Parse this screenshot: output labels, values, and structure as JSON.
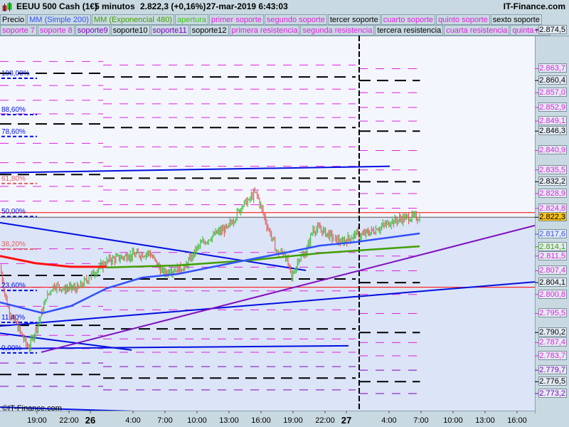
{
  "header": {
    "title": "EEUU 500 Cash (1€)",
    "timeframe": "5 minutos",
    "price": "2.822,3 (+0,16%)",
    "datetime": "27-mar-2019 6:43:03",
    "brand": "IT-Finance.com"
  },
  "legend_row1": [
    {
      "label": "Precio",
      "color": "#000000"
    },
    {
      "label": "MM (Simple 200)",
      "color": "#3050ff"
    },
    {
      "label": "MM (Exponencial 480)",
      "color": "#40a000"
    },
    {
      "label": "apertura",
      "color": "#40c020"
    },
    {
      "label": "primer soporte",
      "color": "#e020e0"
    },
    {
      "label": "segundo soporte",
      "color": "#e020e0"
    },
    {
      "label": "tercer soporte",
      "color": "#000000"
    },
    {
      "label": "cuarto soporte",
      "color": "#e020e0"
    },
    {
      "label": "quinto soporte",
      "color": "#e020e0"
    },
    {
      "label": "sexto soporte",
      "color": "#000000"
    }
  ],
  "legend_row2": [
    {
      "label": "soporte 7",
      "color": "#e020e0"
    },
    {
      "label": "soporte 8",
      "color": "#e020e0"
    },
    {
      "label": "soporte9",
      "color": "#8000c0"
    },
    {
      "label": "soporte10",
      "color": "#000000"
    },
    {
      "label": "soporte11",
      "color": "#8000c0"
    },
    {
      "label": "soporte12",
      "color": "#000000"
    },
    {
      "label": "primera resistencia",
      "color": "#e020e0"
    },
    {
      "label": "segunda resistencia",
      "color": "#e020e0"
    },
    {
      "label": "tercera resistencia",
      "color": "#000000"
    },
    {
      "label": "cuarta resistencia",
      "color": "#e020e0"
    },
    {
      "label": "quinta resi",
      "color": "#e020e0"
    }
  ],
  "copyright": "©IT-Finance.com",
  "chart_data": {
    "type": "candlestick",
    "title": "EEUU 500 Cash (1€) 5 minutos",
    "xunit": "hours from 26-mar 00:00",
    "xlim": [
      -8.47,
      41.67
    ],
    "ylim": [
      2767.0,
      2874.5
    ],
    "price": {
      "t": [
        -8.47,
        -7.8,
        -7.13,
        -5.8,
        -4.8,
        -4.13,
        -3.47,
        -2.47,
        -1.13,
        -0.13,
        0.87,
        1.87,
        3.53,
        5.53,
        6.87,
        7.53,
        8.87,
        10.2,
        11.53,
        12.87,
        14.2,
        14.87,
        15.53,
        16.2,
        16.87,
        17.53,
        18.2,
        18.87,
        19.53,
        20.2,
        20.87,
        21.53,
        22.87,
        23.53,
        24.87,
        25.53,
        26.87,
        28.2,
        29.53,
        30.87
      ],
      "p": [
        2808.5,
        2797.6,
        2793.6,
        2785.7,
        2793.6,
        2799.6,
        2803.5,
        2802.5,
        2802.5,
        2805.5,
        2808.5,
        2810.5,
        2811.5,
        2812.4,
        2806.5,
        2807.5,
        2808.5,
        2814.4,
        2817.4,
        2819.4,
        2825.3,
        2827.3,
        2829.3,
        2823.3,
        2817.4,
        2812.4,
        2812.4,
        2805.5,
        2810.5,
        2812.4,
        2819.0,
        2819.0,
        2816.4,
        2815.4,
        2817.4,
        2817.4,
        2819.0,
        2821.0,
        2822.3,
        2822.3
      ]
    },
    "ma200": {
      "name": "MM (Simple 200)",
      "color": "#3050ff",
      "t": [
        -8.47,
        -4.47,
        -1.8,
        1.53,
        4.87,
        8.2,
        11.53,
        14.87,
        18.2,
        21.53,
        24.87,
        30.87
      ],
      "p": [
        2798.6,
        2795.6,
        2797.6,
        2802.5,
        2805.5,
        2806.5,
        2808.5,
        2810.5,
        2812.4,
        2814.4,
        2815.4,
        2817.8
      ]
    },
    "ema_red": {
      "color": "#ff1010",
      "t": [
        -8.47,
        -5.13,
        -1.8,
        1.53
      ],
      "p": [
        2811.5,
        2809.5,
        2808.5,
        2808.5
      ]
    },
    "ema480": {
      "name": "MM (Exponencial 480)",
      "color": "#40a000",
      "t": [
        1.53,
        8.2,
        14.87,
        21.53,
        24.87,
        30.87
      ],
      "p": [
        2808.3,
        2808.9,
        2810.3,
        2812.3,
        2813.0,
        2814.2
      ]
    },
    "trendlines": [
      {
        "color": "#0010e0",
        "from": [
          -8.47,
          2834.7
        ],
        "to": [
          28.07,
          2836.5
        ]
      },
      {
        "color": "#0010e0",
        "from": [
          -8.47,
          2820.8
        ],
        "to": [
          20.2,
          2807.5
        ]
      },
      {
        "color": "#0010e0",
        "from": [
          -8.47,
          2792.0
        ],
        "to": [
          41.67,
          2804.3
        ]
      },
      {
        "color": "#0010e0",
        "from": [
          -8.47,
          2790.0
        ],
        "to": [
          3.87,
          2785.3
        ]
      },
      {
        "color": "#0010e0",
        "from": [
          -8.47,
          2785.7
        ],
        "to": [
          24.2,
          2786.5
        ]
      },
      {
        "color": "#0010e0",
        "from": [
          -8.47,
          2769.4
        ],
        "to": [
          8.87,
          2767.8
        ]
      },
      {
        "color": "#8010c0",
        "from": [
          -4.6,
          2784.7
        ],
        "to": [
          41.67,
          2820.0
        ]
      }
    ],
    "hlines": [
      {
        "color": "#ff0000",
        "p": 2823.6
      },
      {
        "color": "#ff0000",
        "p": 2802.8
      },
      {
        "color": "#555555",
        "p": 2822.3
      }
    ],
    "session_break_t": 25.2,
    "fib": [
      {
        "label": "100,00%",
        "p": 2862.2,
        "color": "#0010e0"
      },
      {
        "label": "88,60%",
        "p": 2852.1,
        "color": "#0010e0"
      },
      {
        "label": "78,60%",
        "p": 2846.0,
        "color": "#0010e0"
      },
      {
        "label": "61,80%",
        "p": 2832.9,
        "color": "#e06060"
      },
      {
        "label": "50,00%",
        "p": 2823.7,
        "color": "#0010e0"
      },
      {
        "label": "38,20%",
        "p": 2814.6,
        "color": "#e06060"
      },
      {
        "label": "23,60%",
        "p": 2803.1,
        "color": "#0010e0"
      },
      {
        "label": "11,40%",
        "p": 2794.2,
        "color": "#0010e0"
      },
      {
        "label": "0,00%",
        "p": 2785.7,
        "color": "#0010e0"
      }
    ],
    "level_segments": [
      {
        "t0": -8.47,
        "t1": 1.2,
        "shift": 2.0
      },
      {
        "t0": 1.2,
        "t1": 24.87,
        "shift": 1.0
      },
      {
        "t0": 25.2,
        "t1": 30.9,
        "shift": 0
      }
    ],
    "axis_labels": [
      {
        "label": "2.874,5",
        "p": 2874.5,
        "color": "#000000"
      },
      {
        "label": "2.863,7",
        "p": 2863.7,
        "color": "#e020e0"
      },
      {
        "label": "2.860,4",
        "p": 2860.4,
        "color": "#000000"
      },
      {
        "label": "2.857,0",
        "p": 2857.0,
        "color": "#e020e0"
      },
      {
        "label": "2.852,9",
        "p": 2852.9,
        "color": "#e020e0"
      },
      {
        "label": "2.849,1",
        "p": 2849.1,
        "color": "#e020e0"
      },
      {
        "label": "2.846,3",
        "p": 2846.3,
        "color": "#000000"
      },
      {
        "label": "2.840,9",
        "p": 2840.9,
        "color": "#e020e0"
      },
      {
        "label": "2.835,5",
        "p": 2835.5,
        "color": "#e020e0"
      },
      {
        "label": "2.832,2",
        "p": 2832.2,
        "color": "#000000"
      },
      {
        "label": "2.828,9",
        "p": 2828.9,
        "color": "#e020e0"
      },
      {
        "label": "2.824,8",
        "p": 2824.8,
        "color": "#e020e0"
      },
      {
        "label": "2.822,3",
        "p": 2822.3,
        "color": "#000000",
        "current": true
      },
      {
        "label": "2.817,6",
        "p": 2817.6,
        "color": "#3050ff"
      },
      {
        "label": "2.814,1",
        "p": 2814.1,
        "color": "#40a000"
      },
      {
        "label": "2.811,5",
        "p": 2811.5,
        "color": "#e020e0"
      },
      {
        "label": "2.807,4",
        "p": 2807.4,
        "color": "#e020e0"
      },
      {
        "label": "2.804,1",
        "p": 2804.1,
        "color": "#000000"
      },
      {
        "label": "2.800,8",
        "p": 2800.8,
        "color": "#e020e0"
      },
      {
        "label": "2.795,5",
        "p": 2795.5,
        "color": "#e020e0"
      },
      {
        "label": "2.790,2",
        "p": 2790.2,
        "color": "#000000"
      },
      {
        "label": "2.787,4",
        "p": 2787.4,
        "color": "#e020e0"
      },
      {
        "label": "2.783,7",
        "p": 2783.7,
        "color": "#e020e0"
      },
      {
        "label": "2.779,7",
        "p": 2779.7,
        "color": "#8000c0"
      },
      {
        "label": "2.776,5",
        "p": 2776.5,
        "color": "#000000"
      },
      {
        "label": "2.773,2",
        "p": 2773.2,
        "color": "#8000c0"
      }
    ],
    "time_ticks": [
      {
        "label": "19:00",
        "t": -5
      },
      {
        "label": "22:00",
        "t": -2
      },
      {
        "label": "26",
        "t": 0,
        "bold": true
      },
      {
        "label": "4:00",
        "t": 4
      },
      {
        "label": "7:00",
        "t": 7
      },
      {
        "label": "10:00",
        "t": 10
      },
      {
        "label": "13:00",
        "t": 13
      },
      {
        "label": "16:00",
        "t": 16
      },
      {
        "label": "19:00",
        "t": 19
      },
      {
        "label": "22:00",
        "t": 22
      },
      {
        "label": "27",
        "t": 24,
        "bold": true
      },
      {
        "label": "4:00",
        "t": 28
      },
      {
        "label": "7:00",
        "t": 31
      },
      {
        "label": "10:00",
        "t": 34
      },
      {
        "label": "13:00",
        "t": 37
      },
      {
        "label": "16:00",
        "t": 40
      }
    ]
  }
}
